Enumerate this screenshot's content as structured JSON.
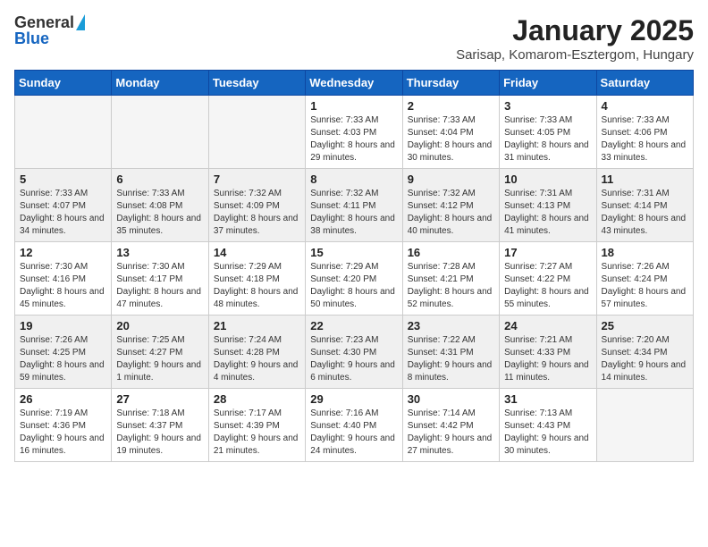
{
  "logo": {
    "line1": "General",
    "line2": "Blue"
  },
  "title": "January 2025",
  "subtitle": "Sarisap, Komarom-Esztergom, Hungary",
  "days_of_week": [
    "Sunday",
    "Monday",
    "Tuesday",
    "Wednesday",
    "Thursday",
    "Friday",
    "Saturday"
  ],
  "weeks": [
    [
      {
        "day": "",
        "text": ""
      },
      {
        "day": "",
        "text": ""
      },
      {
        "day": "",
        "text": ""
      },
      {
        "day": "1",
        "text": "Sunrise: 7:33 AM\nSunset: 4:03 PM\nDaylight: 8 hours and 29 minutes."
      },
      {
        "day": "2",
        "text": "Sunrise: 7:33 AM\nSunset: 4:04 PM\nDaylight: 8 hours and 30 minutes."
      },
      {
        "day": "3",
        "text": "Sunrise: 7:33 AM\nSunset: 4:05 PM\nDaylight: 8 hours and 31 minutes."
      },
      {
        "day": "4",
        "text": "Sunrise: 7:33 AM\nSunset: 4:06 PM\nDaylight: 8 hours and 33 minutes."
      }
    ],
    [
      {
        "day": "5",
        "text": "Sunrise: 7:33 AM\nSunset: 4:07 PM\nDaylight: 8 hours and 34 minutes."
      },
      {
        "day": "6",
        "text": "Sunrise: 7:33 AM\nSunset: 4:08 PM\nDaylight: 8 hours and 35 minutes."
      },
      {
        "day": "7",
        "text": "Sunrise: 7:32 AM\nSunset: 4:09 PM\nDaylight: 8 hours and 37 minutes."
      },
      {
        "day": "8",
        "text": "Sunrise: 7:32 AM\nSunset: 4:11 PM\nDaylight: 8 hours and 38 minutes."
      },
      {
        "day": "9",
        "text": "Sunrise: 7:32 AM\nSunset: 4:12 PM\nDaylight: 8 hours and 40 minutes."
      },
      {
        "day": "10",
        "text": "Sunrise: 7:31 AM\nSunset: 4:13 PM\nDaylight: 8 hours and 41 minutes."
      },
      {
        "day": "11",
        "text": "Sunrise: 7:31 AM\nSunset: 4:14 PM\nDaylight: 8 hours and 43 minutes."
      }
    ],
    [
      {
        "day": "12",
        "text": "Sunrise: 7:30 AM\nSunset: 4:16 PM\nDaylight: 8 hours and 45 minutes."
      },
      {
        "day": "13",
        "text": "Sunrise: 7:30 AM\nSunset: 4:17 PM\nDaylight: 8 hours and 47 minutes."
      },
      {
        "day": "14",
        "text": "Sunrise: 7:29 AM\nSunset: 4:18 PM\nDaylight: 8 hours and 48 minutes."
      },
      {
        "day": "15",
        "text": "Sunrise: 7:29 AM\nSunset: 4:20 PM\nDaylight: 8 hours and 50 minutes."
      },
      {
        "day": "16",
        "text": "Sunrise: 7:28 AM\nSunset: 4:21 PM\nDaylight: 8 hours and 52 minutes."
      },
      {
        "day": "17",
        "text": "Sunrise: 7:27 AM\nSunset: 4:22 PM\nDaylight: 8 hours and 55 minutes."
      },
      {
        "day": "18",
        "text": "Sunrise: 7:26 AM\nSunset: 4:24 PM\nDaylight: 8 hours and 57 minutes."
      }
    ],
    [
      {
        "day": "19",
        "text": "Sunrise: 7:26 AM\nSunset: 4:25 PM\nDaylight: 8 hours and 59 minutes."
      },
      {
        "day": "20",
        "text": "Sunrise: 7:25 AM\nSunset: 4:27 PM\nDaylight: 9 hours and 1 minute."
      },
      {
        "day": "21",
        "text": "Sunrise: 7:24 AM\nSunset: 4:28 PM\nDaylight: 9 hours and 4 minutes."
      },
      {
        "day": "22",
        "text": "Sunrise: 7:23 AM\nSunset: 4:30 PM\nDaylight: 9 hours and 6 minutes."
      },
      {
        "day": "23",
        "text": "Sunrise: 7:22 AM\nSunset: 4:31 PM\nDaylight: 9 hours and 8 minutes."
      },
      {
        "day": "24",
        "text": "Sunrise: 7:21 AM\nSunset: 4:33 PM\nDaylight: 9 hours and 11 minutes."
      },
      {
        "day": "25",
        "text": "Sunrise: 7:20 AM\nSunset: 4:34 PM\nDaylight: 9 hours and 14 minutes."
      }
    ],
    [
      {
        "day": "26",
        "text": "Sunrise: 7:19 AM\nSunset: 4:36 PM\nDaylight: 9 hours and 16 minutes."
      },
      {
        "day": "27",
        "text": "Sunrise: 7:18 AM\nSunset: 4:37 PM\nDaylight: 9 hours and 19 minutes."
      },
      {
        "day": "28",
        "text": "Sunrise: 7:17 AM\nSunset: 4:39 PM\nDaylight: 9 hours and 21 minutes."
      },
      {
        "day": "29",
        "text": "Sunrise: 7:16 AM\nSunset: 4:40 PM\nDaylight: 9 hours and 24 minutes."
      },
      {
        "day": "30",
        "text": "Sunrise: 7:14 AM\nSunset: 4:42 PM\nDaylight: 9 hours and 27 minutes."
      },
      {
        "day": "31",
        "text": "Sunrise: 7:13 AM\nSunset: 4:43 PM\nDaylight: 9 hours and 30 minutes."
      },
      {
        "day": "",
        "text": ""
      }
    ]
  ]
}
